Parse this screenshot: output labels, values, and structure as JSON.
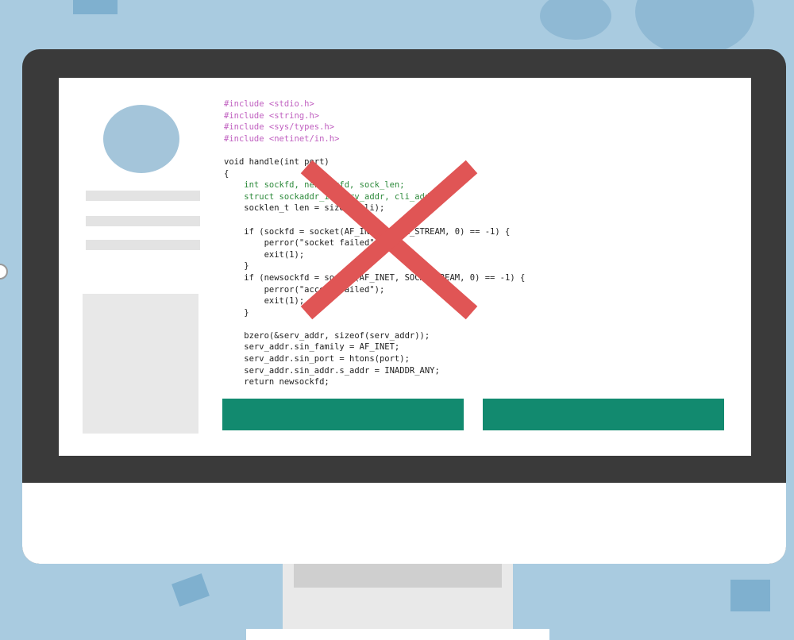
{
  "colors": {
    "background": "#a9cbe0",
    "monitor_bezel": "#3a3a3a",
    "screen": "#ffffff",
    "avatar": "#a4c5da",
    "button_fill": "#128a6f",
    "cross": "#e05555",
    "code_keyword_pink": "#c060c0",
    "code_keyword_green": "#2d8a3b"
  },
  "icons": {
    "cross": "red-x-icon",
    "avatar": "user-avatar-icon"
  },
  "code_lines": [
    {
      "text": "#include <stdio.h>",
      "cls": "kw-pink"
    },
    {
      "text": "#include <string.h>",
      "cls": "kw-pink"
    },
    {
      "text": "#include <sys/types.h>",
      "cls": "kw-pink"
    },
    {
      "text": "#include <netinet/in.h>",
      "cls": "kw-pink"
    },
    {
      "text": "",
      "cls": ""
    },
    {
      "text": "void handle(int port)",
      "cls": ""
    },
    {
      "text": "{",
      "cls": ""
    },
    {
      "text": "    int sockfd, newsockfd, sock_len;",
      "cls": "kw-green"
    },
    {
      "text": "    struct sockaddr_in serv_addr, cli_addr;",
      "cls": "kw-green"
    },
    {
      "text": "    socklen_t len = sizeof(cli);",
      "cls": ""
    },
    {
      "text": "",
      "cls": ""
    },
    {
      "text": "    if (sockfd = socket(AF_INET, SOCK_STREAM, 0) == -1) {",
      "cls": ""
    },
    {
      "text": "        perror(\"socket failed\");",
      "cls": ""
    },
    {
      "text": "        exit(1);",
      "cls": ""
    },
    {
      "text": "    }",
      "cls": ""
    },
    {
      "text": "    if (newsockfd = socket(AF_INET, SOCK_STREAM, 0) == -1) {",
      "cls": ""
    },
    {
      "text": "        perror(\"accept failed\");",
      "cls": ""
    },
    {
      "text": "        exit(1);",
      "cls": ""
    },
    {
      "text": "    }",
      "cls": ""
    },
    {
      "text": "",
      "cls": ""
    },
    {
      "text": "    bzero(&serv_addr, sizeof(serv_addr));",
      "cls": ""
    },
    {
      "text": "    serv_addr.sin_family = AF_INET;",
      "cls": ""
    },
    {
      "text": "    serv_addr.sin_port = htons(port);",
      "cls": ""
    },
    {
      "text": "    serv_addr.sin_addr.s_addr = INADDR_ANY;",
      "cls": ""
    },
    {
      "text": "    return newsockfd;",
      "cls": ""
    }
  ],
  "buttons": [
    {
      "label": ""
    },
    {
      "label": ""
    }
  ]
}
